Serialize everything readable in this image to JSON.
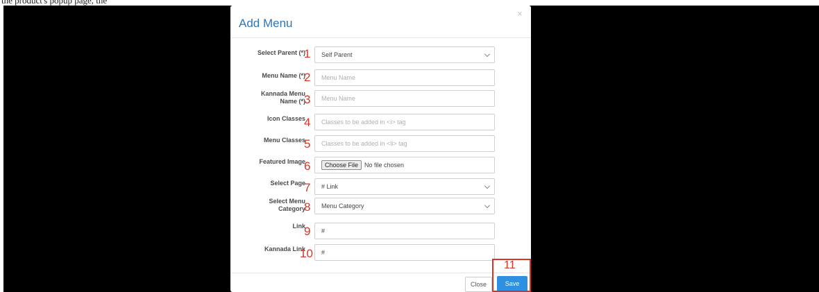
{
  "caption": "the product's popup page, the",
  "modal": {
    "title": "Add Menu",
    "close_glyph": "×"
  },
  "fields": [
    {
      "label": "Select Parent (*)",
      "number": "1",
      "type": "select",
      "value": "Self Parent"
    },
    {
      "label": "Menu Name (*)",
      "number": "2",
      "type": "text",
      "placeholder": "Menu Name"
    },
    {
      "label": "Kannada Menu\nName (*)",
      "number": "3",
      "type": "text",
      "placeholder": "Menu Name"
    },
    {
      "label": "Icon Classes",
      "number": "4",
      "type": "text",
      "placeholder": "Classes to be added in <i> tag"
    },
    {
      "label": "Menu Classes",
      "number": "5",
      "type": "text",
      "placeholder": "Classes to be added in <li> tag"
    },
    {
      "label": "Featured Image",
      "number": "6",
      "type": "file",
      "button": "Choose File",
      "value": "No file chosen"
    },
    {
      "label": "Select Page",
      "number": "7",
      "type": "select",
      "value": "# Link"
    },
    {
      "label": "Select Menu\nCategory",
      "number": "8",
      "type": "select",
      "value": "Menu Category"
    },
    {
      "label": "Link",
      "number": "9",
      "type": "text",
      "value": "#"
    },
    {
      "label": "Kannada Link",
      "number": "10",
      "type": "text",
      "value": "#"
    }
  ],
  "footer": {
    "close_label": "Close",
    "save_label": "Save",
    "save_marker": "11"
  },
  "colors": {
    "backdrop": "#000000",
    "title": "#2e76b6",
    "marker": "#d93526",
    "save": "#2f8fe0"
  }
}
